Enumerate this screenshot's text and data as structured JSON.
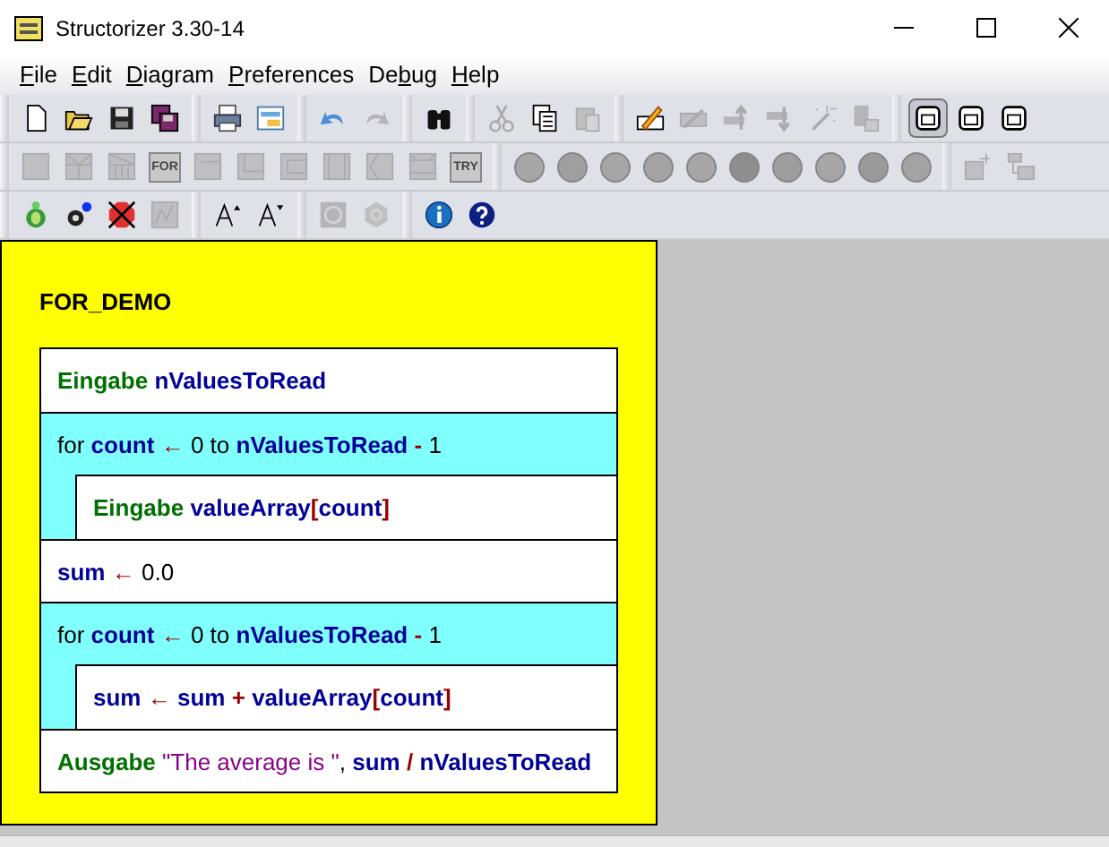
{
  "window": {
    "title": "Structorizer 3.30-14"
  },
  "menu": [
    {
      "mnemonic": "F",
      "rest": "ile"
    },
    {
      "mnemonic": "E",
      "rest": "dit"
    },
    {
      "mnemonic": "D",
      "rest": "iagram"
    },
    {
      "mnemonic": "P",
      "rest": "references"
    },
    {
      "before": "De",
      "mnemonic": "b",
      "rest": "ug"
    },
    {
      "mnemonic": "H",
      "rest": "elp"
    }
  ],
  "toolbars": [
    [
      [
        {
          "kind": "new",
          "disabled": false
        },
        {
          "kind": "open",
          "disabled": false
        },
        {
          "kind": "save",
          "disabled": false
        },
        {
          "kind": "saveall",
          "disabled": false
        }
      ],
      [
        {
          "kind": "print",
          "disabled": false
        },
        {
          "kind": "picture",
          "disabled": false
        }
      ],
      [
        {
          "kind": "undo",
          "disabled": false
        },
        {
          "kind": "redo",
          "disabled": true
        }
      ],
      [
        {
          "kind": "find",
          "disabled": false
        }
      ],
      [
        {
          "kind": "cut",
          "disabled": true
        },
        {
          "kind": "copy",
          "disabled": false
        },
        {
          "kind": "paste",
          "disabled": true
        }
      ],
      [
        {
          "kind": "edit",
          "disabled": false
        },
        {
          "kind": "delete",
          "disabled": true
        },
        {
          "kind": "moveup",
          "disabled": true
        },
        {
          "kind": "movedown",
          "disabled": true
        },
        {
          "kind": "transmute",
          "disabled": true
        },
        {
          "kind": "collapse",
          "disabled": true
        }
      ],
      [
        {
          "kind": "view",
          "disabled": false,
          "selected": true
        },
        {
          "kind": "view",
          "disabled": false,
          "selected": false
        },
        {
          "kind": "view",
          "disabled": false,
          "selected": false
        }
      ]
    ],
    [
      [
        {
          "kind": "instruction",
          "disabled": true
        },
        {
          "kind": "alternative",
          "disabled": true
        },
        {
          "kind": "case",
          "disabled": true
        },
        {
          "kind": "forloop",
          "disabled": true,
          "label": "FOR"
        },
        {
          "kind": "while",
          "disabled": true
        },
        {
          "kind": "repeat",
          "disabled": true
        },
        {
          "kind": "forever",
          "disabled": true
        },
        {
          "kind": "call",
          "disabled": true
        },
        {
          "kind": "jump",
          "disabled": true
        },
        {
          "kind": "parallel",
          "disabled": true
        },
        {
          "kind": "try",
          "disabled": true,
          "label": "TRY"
        }
      ],
      [
        {
          "kind": "circle",
          "disabled": true,
          "color": "#a6a6a6"
        },
        {
          "kind": "circle",
          "disabled": true,
          "color": "#a0a0a0"
        },
        {
          "kind": "circle",
          "disabled": true,
          "color": "#a6a6a6"
        },
        {
          "kind": "circle",
          "disabled": true,
          "color": "#a3a3a3"
        },
        {
          "kind": "circle",
          "disabled": true,
          "color": "#a6a6a6"
        },
        {
          "kind": "circle",
          "disabled": true,
          "color": "#8e8e8e"
        },
        {
          "kind": "circle",
          "disabled": true,
          "color": "#9e9e9e"
        },
        {
          "kind": "circle",
          "disabled": true,
          "color": "#a6a6a6"
        },
        {
          "kind": "circle",
          "disabled": true,
          "color": "#9a9a9a"
        },
        {
          "kind": "circle",
          "disabled": true,
          "color": "#a3a3a3"
        }
      ],
      [
        {
          "kind": "outsource",
          "disabled": true
        },
        {
          "kind": "subroutine",
          "disabled": true
        }
      ]
    ],
    [
      [
        {
          "kind": "turtle",
          "disabled": false
        },
        {
          "kind": "gears",
          "disabled": false
        },
        {
          "kind": "stop",
          "disabled": false
        },
        {
          "kind": "chart",
          "disabled": true
        }
      ],
      [
        {
          "kind": "fontup",
          "disabled": false
        },
        {
          "kind": "fontdown",
          "disabled": false
        }
      ],
      [
        {
          "kind": "shape",
          "disabled": true
        },
        {
          "kind": "hexagon",
          "disabled": true
        }
      ],
      [
        {
          "kind": "info",
          "disabled": false
        },
        {
          "kind": "help",
          "disabled": false
        }
      ]
    ]
  ],
  "diagram": {
    "title": "FOR_DEMO",
    "blocks": [
      {
        "kind": "instruction",
        "tokens": [
          {
            "text": "Eingabe",
            "kind": "keyword"
          },
          {
            "text": "nValuesToRead",
            "kind": "var"
          }
        ]
      },
      {
        "kind": "loop",
        "tokens": [
          {
            "text": "for",
            "kind": "plain"
          },
          {
            "text": "count",
            "kind": "var"
          },
          {
            "text": "←",
            "kind": "op"
          },
          {
            "text": "0",
            "kind": "plain"
          },
          {
            "text": "to",
            "kind": "plain"
          },
          {
            "text": "nValuesToRead",
            "kind": "var"
          },
          {
            "text": "-",
            "kind": "op"
          },
          {
            "text": "1",
            "kind": "plain"
          }
        ],
        "body": [
          {
            "kind": "instruction",
            "tokens": [
              {
                "text": "Eingabe",
                "kind": "keyword"
              },
              {
                "text": "valueArray",
                "kind": "var"
              },
              {
                "text": "[",
                "kind": "bracket",
                "attach": true
              },
              {
                "text": "count",
                "kind": "var",
                "attach": true
              },
              {
                "text": "]",
                "kind": "bracket",
                "attach": true
              }
            ]
          }
        ]
      },
      {
        "kind": "instruction",
        "tokens": [
          {
            "text": "sum",
            "kind": "var"
          },
          {
            "text": "←",
            "kind": "op"
          },
          {
            "text": "0.0",
            "kind": "plain"
          }
        ]
      },
      {
        "kind": "loop",
        "tokens": [
          {
            "text": "for",
            "kind": "plain"
          },
          {
            "text": "count",
            "kind": "var"
          },
          {
            "text": "←",
            "kind": "op"
          },
          {
            "text": "0",
            "kind": "plain"
          },
          {
            "text": "to",
            "kind": "plain"
          },
          {
            "text": "nValuesToRead",
            "kind": "var"
          },
          {
            "text": "-",
            "kind": "op"
          },
          {
            "text": "1",
            "kind": "plain"
          }
        ],
        "body": [
          {
            "kind": "instruction",
            "tokens": [
              {
                "text": "sum",
                "kind": "var"
              },
              {
                "text": "←",
                "kind": "op"
              },
              {
                "text": "sum",
                "kind": "var"
              },
              {
                "text": "+",
                "kind": "op"
              },
              {
                "text": "valueArray",
                "kind": "var"
              },
              {
                "text": "[",
                "kind": "bracket",
                "attach": true
              },
              {
                "text": "count",
                "kind": "var",
                "attach": true
              },
              {
                "text": "]",
                "kind": "bracket",
                "attach": true
              }
            ]
          }
        ]
      },
      {
        "kind": "instruction",
        "tokens": [
          {
            "text": "Ausgabe",
            "kind": "keyword"
          },
          {
            "text": "\"The average is \"",
            "kind": "string"
          },
          {
            "text": ",",
            "kind": "plain",
            "attach": true
          },
          {
            "text": "sum",
            "kind": "var"
          },
          {
            "text": "/",
            "kind": "op"
          },
          {
            "text": "nValuesToRead",
            "kind": "var"
          }
        ]
      }
    ]
  }
}
